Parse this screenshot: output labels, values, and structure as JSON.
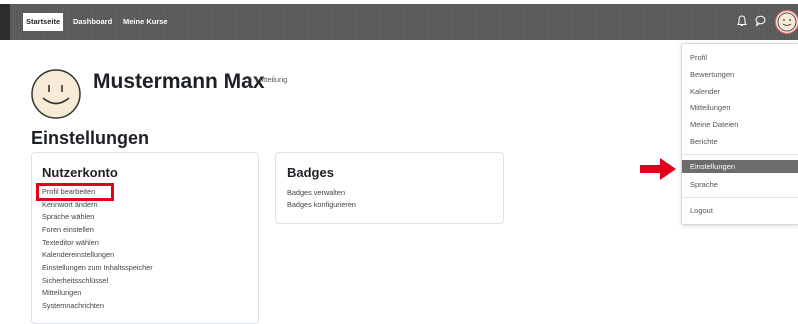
{
  "nav": {
    "items": [
      "Startseite",
      "Dashboard",
      "Meine Kurse"
    ],
    "icons": [
      "bell-icon",
      "chat-icon",
      "avatar"
    ]
  },
  "profile": {
    "name": "Mustermann Max",
    "message_link": "Mitteilung"
  },
  "page_title": "Einstellungen",
  "account_card": {
    "title": "Nutzerkonto",
    "links": [
      "Profil bearbeiten",
      "Kennwort ändern",
      "Sprache wählen",
      "Foren einstellen",
      "Texteditor wählen",
      "Kalendereinstellungen",
      "Einstellungen zum Inhaltsspeicher",
      "Sicherheitsschlüssel",
      "Mitteilungen",
      "Systemnachrichten"
    ]
  },
  "badges_card": {
    "title": "Badges",
    "links": [
      "Badges verwalten",
      "Badges konfigurieren"
    ]
  },
  "dropdown": {
    "items": [
      "Profil",
      "Bewertungen",
      "Kalender",
      "Mitteilungen",
      "Meine Dateien",
      "Berichte"
    ],
    "settings": "Einstellungen",
    "language": "Sprache",
    "logout": "Logout"
  },
  "colors": {
    "navbar": "#5a5a5a",
    "highlight_red": "#e0001b",
    "dropdown_active": "#6c6c6c"
  }
}
